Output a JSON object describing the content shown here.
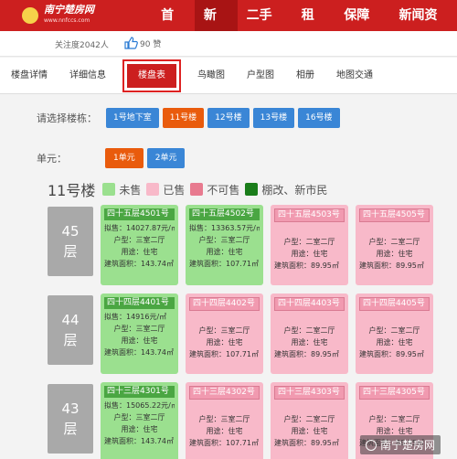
{
  "header": {
    "logo_title": "南宁楚房网",
    "logo_sub": "www.nnfccs.com",
    "nav": [
      {
        "label": "首页",
        "active": false
      },
      {
        "label": "新房",
        "active": true
      },
      {
        "label": "二手房",
        "active": false
      },
      {
        "label": "租房",
        "active": false
      },
      {
        "label": "保障房",
        "active": false
      },
      {
        "label": "新闻资讯",
        "active": false
      }
    ]
  },
  "follow": {
    "count_text": "关注度2042人",
    "likes_text": "90 赞"
  },
  "tabs": [
    "楼盘详情",
    "详细信息",
    "楼盘表",
    "鸟瞰图",
    "户型图",
    "相册",
    "地图交通"
  ],
  "selector": {
    "label": "请选择楼栋：",
    "buildings": [
      {
        "label": "1号地下室",
        "active": false
      },
      {
        "label": "11号楼",
        "active": true
      },
      {
        "label": "12号楼",
        "active": false
      },
      {
        "label": "13号楼",
        "active": false
      },
      {
        "label": "16号楼",
        "active": false
      }
    ]
  },
  "units": {
    "label": "单元：",
    "items": [
      {
        "label": "1单元",
        "active": true
      },
      {
        "label": "2单元",
        "active": false
      }
    ]
  },
  "legend": {
    "building_title": "11号楼",
    "items": [
      {
        "label": "未售",
        "color": "#9be08f"
      },
      {
        "label": "已售",
        "color": "#f8b9c9"
      },
      {
        "label": "不可售",
        "color": "#e87a8f"
      },
      {
        "label": "棚改、新市民",
        "color": "#1a7d1a"
      }
    ]
  },
  "floors": [
    {
      "floor_num": "45",
      "floor_char": "层",
      "rooms": [
        {
          "status": "sale",
          "no": "四十五层4501号",
          "price": "拟售：14027.87元/㎡",
          "type": "户型：三室二厅",
          "use": "用途：住宅",
          "area": "建筑面积：143.74㎡"
        },
        {
          "status": "sale",
          "no": "四十五层4502号",
          "price": "拟售：13363.57元/㎡",
          "type": "户型：三室二厅",
          "use": "用途：住宅",
          "area": "建筑面积：107.71㎡"
        },
        {
          "status": "sold",
          "no": "四十五层4503号",
          "price": "",
          "type": "户型：二室二厅",
          "use": "用途：住宅",
          "area": "建筑面积：89.95㎡"
        },
        {
          "status": "sold",
          "no": "四十五层4505号",
          "price": "",
          "type": "户型：二室二厅",
          "use": "用途：住宅",
          "area": "建筑面积：89.95㎡"
        }
      ]
    },
    {
      "floor_num": "44",
      "floor_char": "层",
      "rooms": [
        {
          "status": "sale",
          "no": "四十四层4401号",
          "price": "拟售：14916元/㎡",
          "type": "户型：三室二厅",
          "use": "用途：住宅",
          "area": "建筑面积：143.74㎡"
        },
        {
          "status": "sold",
          "no": "四十四层4402号",
          "price": "",
          "type": "户型：三室二厅",
          "use": "用途：住宅",
          "area": "建筑面积：107.71㎡"
        },
        {
          "status": "sold",
          "no": "四十四层4403号",
          "price": "",
          "type": "户型：二室二厅",
          "use": "用途：住宅",
          "area": "建筑面积：89.95㎡"
        },
        {
          "status": "sold",
          "no": "四十四层4405号",
          "price": "",
          "type": "户型：二室二厅",
          "use": "用途：住宅",
          "area": "建筑面积：89.95㎡"
        }
      ]
    },
    {
      "floor_num": "43",
      "floor_char": "层",
      "rooms": [
        {
          "status": "sale",
          "no": "四十三层4301号",
          "price": "拟售：15065.22元/㎡",
          "type": "户型：三室二厅",
          "use": "用途：住宅",
          "area": "建筑面积：143.74㎡"
        },
        {
          "status": "sold",
          "no": "四十三层4302号",
          "price": "",
          "type": "户型：三室二厅",
          "use": "用途：住宅",
          "area": "建筑面积：107.71㎡"
        },
        {
          "status": "sold",
          "no": "四十三层4303号",
          "price": "",
          "type": "户型：二室二厅",
          "use": "用途：住宅",
          "area": "建筑面积：89.95㎡"
        },
        {
          "status": "sold",
          "no": "四十三层4305号",
          "price": "",
          "type": "户型：二室二厅",
          "use": "用途：住宅",
          "area": "建筑面积：89.95㎡"
        }
      ]
    }
  ],
  "watermark": "南宁楚房网"
}
